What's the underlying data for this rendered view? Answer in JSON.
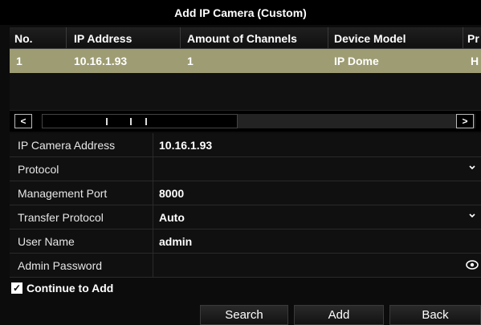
{
  "dialog": {
    "title": "Add IP Camera (Custom)"
  },
  "table": {
    "columns": [
      "No.",
      "IP Address",
      "Amount of Channels",
      "Device Model",
      "Pr"
    ],
    "rows": [
      {
        "no": "1",
        "ip": "10.16.1.93",
        "channels": "1",
        "model": "IP Dome",
        "protocol": "H"
      }
    ]
  },
  "scroll": {
    "left_icon": "chevron-left-icon",
    "right_icon": "chevron-right-icon"
  },
  "form": {
    "ip_camera_address": {
      "label": "IP Camera Address",
      "value": "10.16.1.93"
    },
    "protocol": {
      "label": "Protocol",
      "value": ""
    },
    "management_port": {
      "label": "Management Port",
      "value": "8000"
    },
    "transfer_protocol": {
      "label": "Transfer Protocol",
      "value": "Auto"
    },
    "user_name": {
      "label": "User Name",
      "value": "admin"
    },
    "admin_password": {
      "label": "Admin Password",
      "value": ""
    }
  },
  "continue_to_add": {
    "label": "Continue to Add",
    "checked": true
  },
  "buttons": {
    "search": "Search",
    "add": "Add",
    "back": "Back"
  },
  "colors": {
    "selected_row": "#9d9c73",
    "background": "#0c0c0c"
  }
}
